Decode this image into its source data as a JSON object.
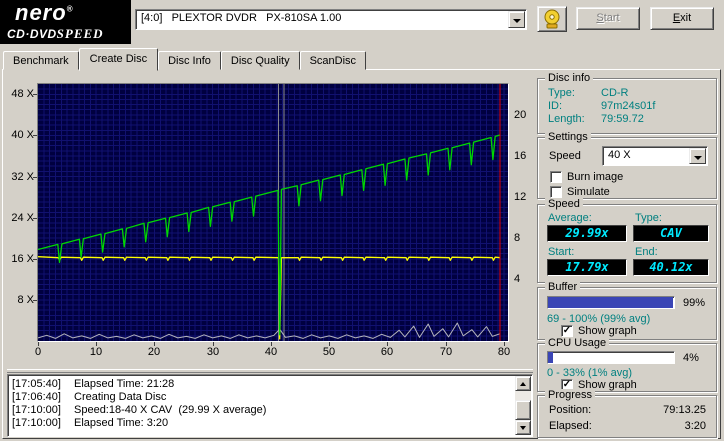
{
  "header": {
    "logo": {
      "line1": "nero",
      "registered": "®",
      "line2_left": "CD·DVD",
      "line2_right": "SPEED"
    },
    "drive_combo": {
      "value": "[4:0]   PLEXTOR DVDR   PX-810SA 1.00"
    },
    "start_label": "Start",
    "exit_label": "Exit"
  },
  "tabs": [
    {
      "label": "Benchmark",
      "active": false
    },
    {
      "label": "Create Disc",
      "active": true
    },
    {
      "label": "Disc Info",
      "active": false
    },
    {
      "label": "Disc Quality",
      "active": false
    },
    {
      "label": "ScanDisc",
      "active": false
    }
  ],
  "chart_data": {
    "type": "line",
    "title": "",
    "bg_color": "#000040",
    "grid_color": "#2a2ab4",
    "x_axis": {
      "min": 0,
      "max": 80.7,
      "ticks": [
        0,
        10,
        20,
        30,
        40,
        50,
        60,
        70,
        80
      ],
      "label": ""
    },
    "y_axis_left": {
      "min": 0,
      "max": 50,
      "ticks": [
        {
          "value": 48,
          "label": "48 X"
        },
        {
          "value": 40,
          "label": "40 X"
        },
        {
          "value": 32,
          "label": "32 X"
        },
        {
          "value": 24,
          "label": "24 X"
        },
        {
          "value": 16,
          "label": "16 X"
        },
        {
          "value": 8,
          "label": "8 X"
        }
      ]
    },
    "y_axis_right": {
      "ticks": [
        {
          "value": 44,
          "label": "20"
        },
        {
          "value": 36,
          "label": "16"
        },
        {
          "value": 28,
          "label": "12"
        },
        {
          "value": 20,
          "label": "8"
        },
        {
          "value": 12,
          "label": "4"
        }
      ]
    },
    "markers": [
      {
        "x": 41.3,
        "color": "#8c8c8c",
        "top": false
      },
      {
        "x": 42.2,
        "color": "#8c8c8c",
        "top": false
      },
      {
        "x": 79.35,
        "color": "#e80000",
        "top": true
      }
    ],
    "series": [
      {
        "name": "cpu-usage",
        "color": "#b4b4bc",
        "width": 1,
        "points": [
          [
            0,
            0.6
          ],
          [
            1.5,
            1.1
          ],
          [
            3,
            0.5
          ],
          [
            4.5,
            1.4
          ],
          [
            6,
            0.6
          ],
          [
            7.5,
            1.0
          ],
          [
            9,
            0.5
          ],
          [
            10.5,
            1.3
          ],
          [
            12,
            0.6
          ],
          [
            13.5,
            0.9
          ],
          [
            15,
            0.5
          ],
          [
            16.5,
            1.2
          ],
          [
            18,
            0.6
          ],
          [
            19.5,
            1.0
          ],
          [
            21,
            0.5
          ],
          [
            22.5,
            1.3
          ],
          [
            24,
            0.6
          ],
          [
            25.5,
            0.9
          ],
          [
            27,
            0.5
          ],
          [
            28.5,
            1.2
          ],
          [
            30,
            0.6
          ],
          [
            31.5,
            1.0
          ],
          [
            33,
            0.5
          ],
          [
            34.5,
            1.2
          ],
          [
            36,
            0.6
          ],
          [
            37.5,
            1.0
          ],
          [
            39,
            0.6
          ],
          [
            40.5,
            1.1
          ],
          [
            41.5,
            2.3
          ],
          [
            42.5,
            0.7
          ],
          [
            44,
            1.0
          ],
          [
            45.5,
            0.5
          ],
          [
            47,
            1.2
          ],
          [
            48.5,
            0.6
          ],
          [
            50,
            1.0
          ],
          [
            51.5,
            0.5
          ],
          [
            53,
            1.2
          ],
          [
            54.5,
            0.6
          ],
          [
            56,
            1.0
          ],
          [
            57.5,
            0.5
          ],
          [
            59,
            1.3
          ],
          [
            60.5,
            0.7
          ],
          [
            62,
            2.1
          ],
          [
            63,
            0.8
          ],
          [
            64.5,
            2.9
          ],
          [
            65.5,
            0.7
          ],
          [
            67,
            3.3
          ],
          [
            68,
            0.9
          ],
          [
            69.5,
            2.4
          ],
          [
            70.5,
            0.8
          ],
          [
            72,
            3.5
          ],
          [
            73,
            1.0
          ],
          [
            74.5,
            2.2
          ],
          [
            75.5,
            0.8
          ],
          [
            77,
            2.8
          ],
          [
            78,
            0.9
          ],
          [
            79.3,
            1.4
          ]
        ]
      },
      {
        "name": "rotation-speed",
        "color": "#ffff00",
        "width": 1.3,
        "points": [
          [
            0,
            16.4
          ],
          [
            3.5,
            16.2
          ],
          [
            3.7,
            15.7
          ],
          [
            4.0,
            16.3
          ],
          [
            7.3,
            16.2
          ],
          [
            7.5,
            15.7
          ],
          [
            7.8,
            16.3
          ],
          [
            11.0,
            16.2
          ],
          [
            11.2,
            15.7
          ],
          [
            11.5,
            16.3
          ],
          [
            14.7,
            16.2
          ],
          [
            14.9,
            15.7
          ],
          [
            15.2,
            16.3
          ],
          [
            18.4,
            16.2
          ],
          [
            18.6,
            15.7
          ],
          [
            18.9,
            16.3
          ],
          [
            22.1,
            16.2
          ],
          [
            22.3,
            15.7
          ],
          [
            22.6,
            16.3
          ],
          [
            25.8,
            16.2
          ],
          [
            26.0,
            15.7
          ],
          [
            26.3,
            16.3
          ],
          [
            29.5,
            16.2
          ],
          [
            29.7,
            15.7
          ],
          [
            30.0,
            16.3
          ],
          [
            33.2,
            16.2
          ],
          [
            33.4,
            15.7
          ],
          [
            33.7,
            16.3
          ],
          [
            36.9,
            16.2
          ],
          [
            37.1,
            15.7
          ],
          [
            37.4,
            16.3
          ],
          [
            41.3,
            16.2
          ],
          [
            41.5,
            0.4
          ],
          [
            41.8,
            16.2
          ],
          [
            44.7,
            16.2
          ],
          [
            44.9,
            15.7
          ],
          [
            45.2,
            16.3
          ],
          [
            48.4,
            16.2
          ],
          [
            48.6,
            15.7
          ],
          [
            48.9,
            16.3
          ],
          [
            52.1,
            16.2
          ],
          [
            52.3,
            15.7
          ],
          [
            52.6,
            16.3
          ],
          [
            55.8,
            16.2
          ],
          [
            56.0,
            15.7
          ],
          [
            56.3,
            16.3
          ],
          [
            59.5,
            16.2
          ],
          [
            59.7,
            15.7
          ],
          [
            60.0,
            16.3
          ],
          [
            63.2,
            16.2
          ],
          [
            63.4,
            15.7
          ],
          [
            63.7,
            16.3
          ],
          [
            66.9,
            16.2
          ],
          [
            67.1,
            15.7
          ],
          [
            67.4,
            16.3
          ],
          [
            70.6,
            16.2
          ],
          [
            70.8,
            15.7
          ],
          [
            71.1,
            16.3
          ],
          [
            74.3,
            16.2
          ],
          [
            74.5,
            15.7
          ],
          [
            74.8,
            16.3
          ],
          [
            78.0,
            16.2
          ],
          [
            78.2,
            15.7
          ],
          [
            78.5,
            16.3
          ],
          [
            79.4,
            16.2
          ]
        ]
      },
      {
        "name": "write-speed",
        "color": "#00d800",
        "width": 1.3,
        "points": [
          [
            0,
            17.8
          ],
          [
            3.4,
            18.8
          ],
          [
            3.7,
            15.3
          ],
          [
            4.1,
            18.9
          ],
          [
            7.1,
            19.8
          ],
          [
            7.4,
            16.3
          ],
          [
            7.8,
            19.9
          ],
          [
            10.8,
            20.8
          ],
          [
            11.1,
            17.3
          ],
          [
            11.5,
            20.9
          ],
          [
            14.5,
            21.8
          ],
          [
            14.8,
            18.3
          ],
          [
            15.2,
            21.9
          ],
          [
            18.2,
            22.9
          ],
          [
            18.5,
            19.3
          ],
          [
            18.9,
            23.0
          ],
          [
            21.9,
            23.9
          ],
          [
            22.2,
            20.3
          ],
          [
            22.6,
            24.0
          ],
          [
            25.6,
            24.9
          ],
          [
            25.9,
            21.3
          ],
          [
            26.3,
            25.0
          ],
          [
            29.3,
            26.0
          ],
          [
            29.6,
            22.3
          ],
          [
            30.0,
            26.1
          ],
          [
            33.0,
            27.0
          ],
          [
            33.3,
            23.3
          ],
          [
            33.7,
            27.1
          ],
          [
            36.7,
            28.0
          ],
          [
            37.0,
            24.3
          ],
          [
            37.4,
            28.2
          ],
          [
            41.2,
            29.3
          ],
          [
            41.5,
            1.2
          ],
          [
            41.8,
            29.5
          ],
          [
            44.5,
            30.2
          ],
          [
            44.8,
            26.3
          ],
          [
            45.2,
            30.4
          ],
          [
            48.2,
            31.3
          ],
          [
            48.5,
            27.3
          ],
          [
            48.9,
            31.4
          ],
          [
            51.9,
            32.3
          ],
          [
            52.2,
            28.3
          ],
          [
            52.6,
            32.4
          ],
          [
            55.6,
            33.3
          ],
          [
            55.9,
            29.3
          ],
          [
            56.3,
            33.5
          ],
          [
            59.3,
            34.4
          ],
          [
            59.6,
            30.3
          ],
          [
            60.0,
            34.5
          ],
          [
            63.0,
            35.4
          ],
          [
            63.3,
            31.3
          ],
          [
            63.7,
            35.6
          ],
          [
            66.7,
            36.4
          ],
          [
            67.0,
            32.3
          ],
          [
            67.4,
            36.6
          ],
          [
            70.4,
            37.5
          ],
          [
            70.7,
            33.3
          ],
          [
            71.1,
            37.6
          ],
          [
            74.1,
            38.5
          ],
          [
            74.4,
            34.3
          ],
          [
            74.8,
            38.7
          ],
          [
            77.8,
            39.6
          ],
          [
            78.1,
            35.3
          ],
          [
            78.5,
            39.8
          ],
          [
            79.4,
            40.1
          ]
        ]
      }
    ]
  },
  "panels": {
    "disc_info": {
      "title": "Disc info",
      "rows": [
        {
          "label": "Type:",
          "value": "CD-R"
        },
        {
          "label": "ID:",
          "value": "97m24s01f"
        },
        {
          "label": "Length:",
          "value": "79:59.72"
        }
      ]
    },
    "settings": {
      "title": "Settings",
      "speed_label": "Speed",
      "speed_value": "40 X",
      "checkboxes": [
        {
          "label": "Burn image",
          "checked": false
        },
        {
          "label": "Simulate",
          "checked": false
        }
      ]
    },
    "speed": {
      "title": "Speed",
      "average_label": "Average:",
      "average_value": "29.99x",
      "type_label": "Type:",
      "type_value": "CAV",
      "start_label": "Start:",
      "start_value": "17.79x",
      "end_label": "End:",
      "end_value": "40.12x"
    },
    "buffer": {
      "title": "Buffer",
      "percent": 99,
      "percent_label": "99%",
      "range": "69 - 100% (99% avg)",
      "show_graph": {
        "label": "Show graph",
        "checked": true
      }
    },
    "cpu": {
      "title": "CPU Usage",
      "percent": 4,
      "percent_label": "4%",
      "range": "0 - 33% (1% avg)",
      "show_graph": {
        "label": "Show graph",
        "checked": true
      }
    },
    "progress": {
      "title": "Progress",
      "position_label": "Position:",
      "position_value": "79:13.25",
      "elapsed_label": "Elapsed:",
      "elapsed_value": "3:20"
    }
  },
  "log": {
    "lines": [
      {
        "time": "[17:05:40]",
        "text": "Elapsed Time: 21:28"
      },
      {
        "time": "[17:06:40]",
        "text": "Creating Data Disc"
      },
      {
        "time": "[17:10:00]",
        "text": "Speed:18-40 X CAV  (29.99 X average)"
      },
      {
        "time": "[17:10:00]",
        "text": "Elapsed Time: 3:20"
      }
    ]
  },
  "colors": {
    "accent_teal": "#008080",
    "lcd_text": "#00eaff",
    "progress_fill": "#3a45b5"
  }
}
